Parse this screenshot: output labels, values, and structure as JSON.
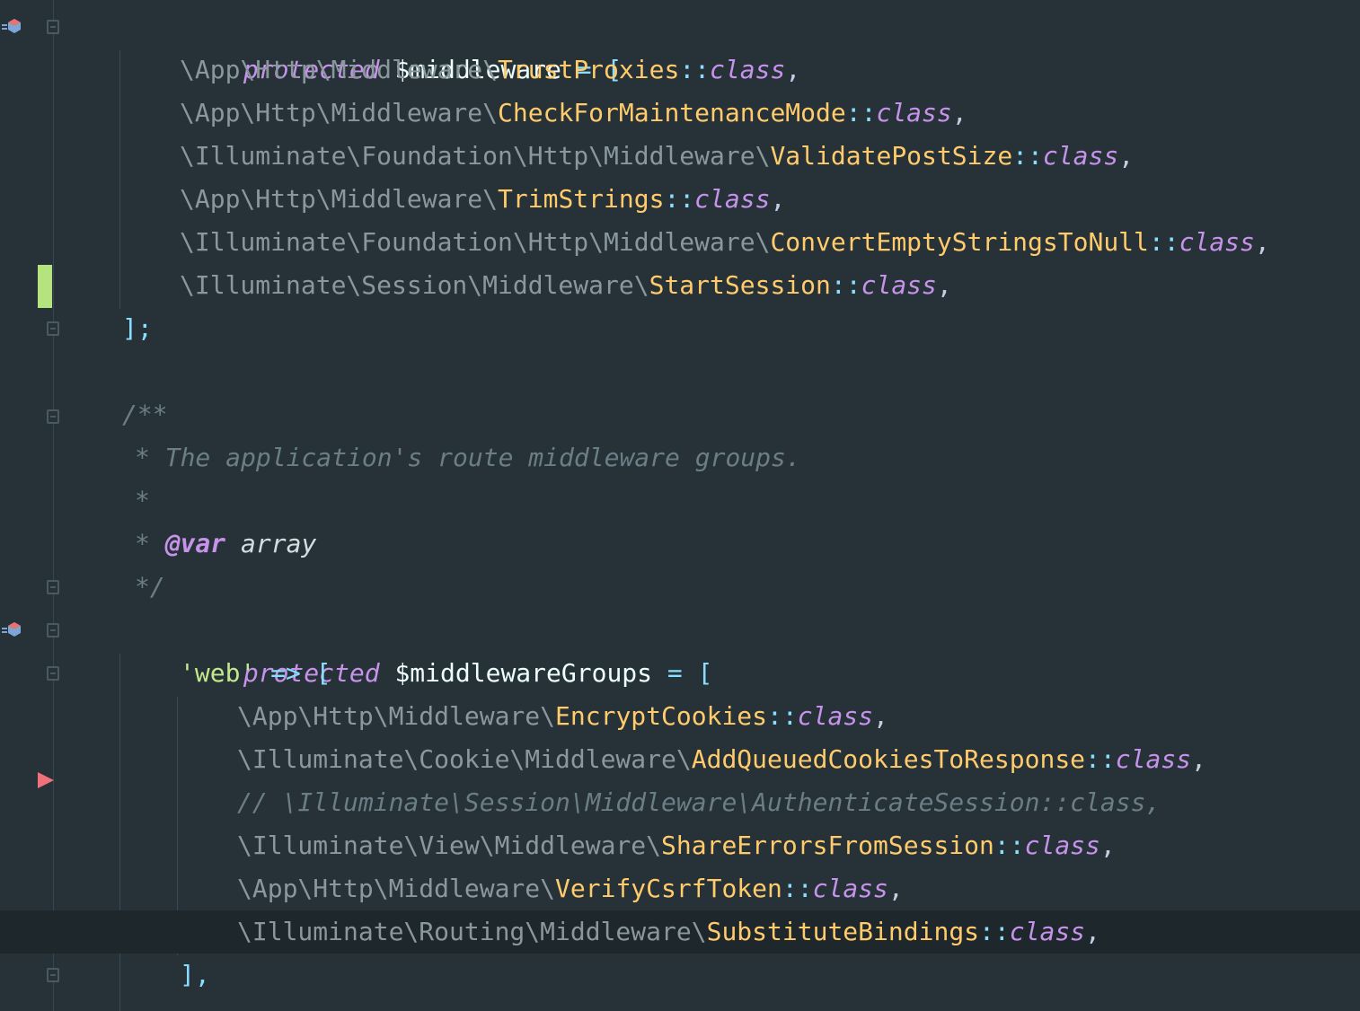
{
  "editor": {
    "theme_colors": {
      "background": "#263238",
      "keyword": "#c792ea",
      "class_name": "#ffcb6b",
      "namespace": "#8a979d",
      "string": "#c3e88d",
      "operator": "#89ddff",
      "comment": "#6b7d85",
      "change_marker": "#b5e37e",
      "breakpoint": "#f0717b"
    },
    "lines": {
      "l1": {
        "kw": "protected",
        "var": "$middleware",
        "op": " = ",
        "bracket": "["
      },
      "l2": {
        "ns": "\\App\\Http\\Middleware\\",
        "cls": "TrustProxies",
        "sep": "::",
        "kw": "class",
        "end": ","
      },
      "l3": {
        "ns": "\\App\\Http\\Middleware\\",
        "cls": "CheckForMaintenanceMode",
        "sep": "::",
        "kw": "class",
        "end": ","
      },
      "l4": {
        "ns": "\\Illuminate\\Foundation\\Http\\Middleware\\",
        "cls": "ValidatePostSize",
        "sep": "::",
        "kw": "class",
        "end": ","
      },
      "l5": {
        "ns": "\\App\\Http\\Middleware\\",
        "cls": "TrimStrings",
        "sep": "::",
        "kw": "class",
        "end": ","
      },
      "l6": {
        "ns": "\\Illuminate\\Foundation\\Http\\Middleware\\",
        "cls": "ConvertEmptyStringsToNull",
        "sep": "::",
        "kw": "class",
        "end": ","
      },
      "l7": {
        "ns": "\\Illuminate\\Session\\Middleware\\",
        "cls": "StartSession",
        "sep": "::",
        "kw": "class",
        "end": ","
      },
      "l8": {
        "close": "];"
      },
      "l10": {
        "comment": "/**"
      },
      "l11": {
        "comment": "* The application's route middleware groups."
      },
      "l12": {
        "comment": "*"
      },
      "l13": {
        "star": "* ",
        "tag": "@var",
        "type": " array"
      },
      "l14": {
        "comment": "*/"
      },
      "l15": {
        "kw": "protected",
        "var": "$middlewareGroups",
        "op": " = ",
        "bracket": "["
      },
      "l16": {
        "str": "'web'",
        "arrow": " => ",
        "bracket": "["
      },
      "l17": {
        "ns": "\\App\\Http\\Middleware\\",
        "cls": "EncryptCookies",
        "sep": "::",
        "kw": "class",
        "end": ","
      },
      "l18": {
        "ns": "\\Illuminate\\Cookie\\Middleware\\",
        "cls": "AddQueuedCookiesToResponse",
        "sep": "::",
        "kw": "class",
        "end": ","
      },
      "l19": {
        "comment": "// \\Illuminate\\Session\\Middleware\\AuthenticateSession::class,"
      },
      "l20": {
        "ns": "\\Illuminate\\View\\Middleware\\",
        "cls": "ShareErrorsFromSession",
        "sep": "::",
        "kw": "class",
        "end": ","
      },
      "l21": {
        "ns": "\\App\\Http\\Middleware\\",
        "cls": "VerifyCsrfToken",
        "sep": "::",
        "kw": "class",
        "end": ","
      },
      "l22": {
        "ns": "\\Illuminate\\Routing\\Middleware\\",
        "cls": "SubstituteBindings",
        "sep": "::",
        "kw": "class",
        "end": ","
      },
      "l23": {
        "close": "],"
      }
    }
  }
}
